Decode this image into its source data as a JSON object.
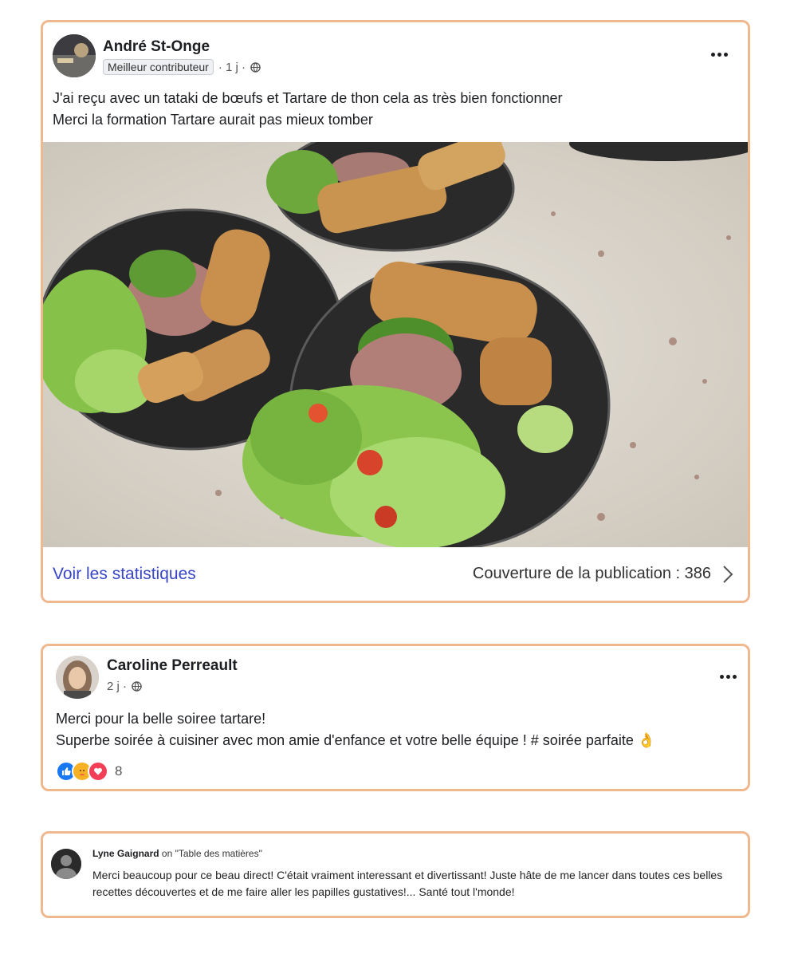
{
  "post1": {
    "author": "André St-Onge",
    "badge": "Meilleur contributeur",
    "time": "· 1 j ·",
    "text_line1": "J'ai reçu avec un tataki de bœufs et Tartare de thon cela as très bien fonctionner",
    "text_line2": "Merci la formation Tartare aurait pas mieux tomber",
    "stats_link": "Voir les statistiques",
    "reach_label": "Couverture de la publication : 386"
  },
  "post2": {
    "author": "Caroline Perreault",
    "time": "2 j ·",
    "text_line1": "Merci pour la belle soiree tartare!",
    "text_line2": "Superbe soirée à cuisiner avec mon amie d'enfance et votre belle équipe ! # soirée parfaite 👌",
    "reaction_count": "8"
  },
  "comment": {
    "author": "Lyne Gaignard",
    "on": "on",
    "target": "\"Table des matières\"",
    "text": "Merci beaucoup pour ce beau direct! C'était vraiment interessant et divertissant! Juste hâte de me lancer dans toutes ces belles recettes découvertes et de me faire aller les papilles gustatives!... Santé tout l'monde!"
  },
  "colors": {
    "card_border": "#efb88e",
    "link": "#3845c7"
  },
  "icons": [
    "more-options-icon",
    "globe-icon",
    "chevron-right-icon",
    "like-icon",
    "care-icon",
    "love-icon",
    "default-avatar-icon"
  ]
}
